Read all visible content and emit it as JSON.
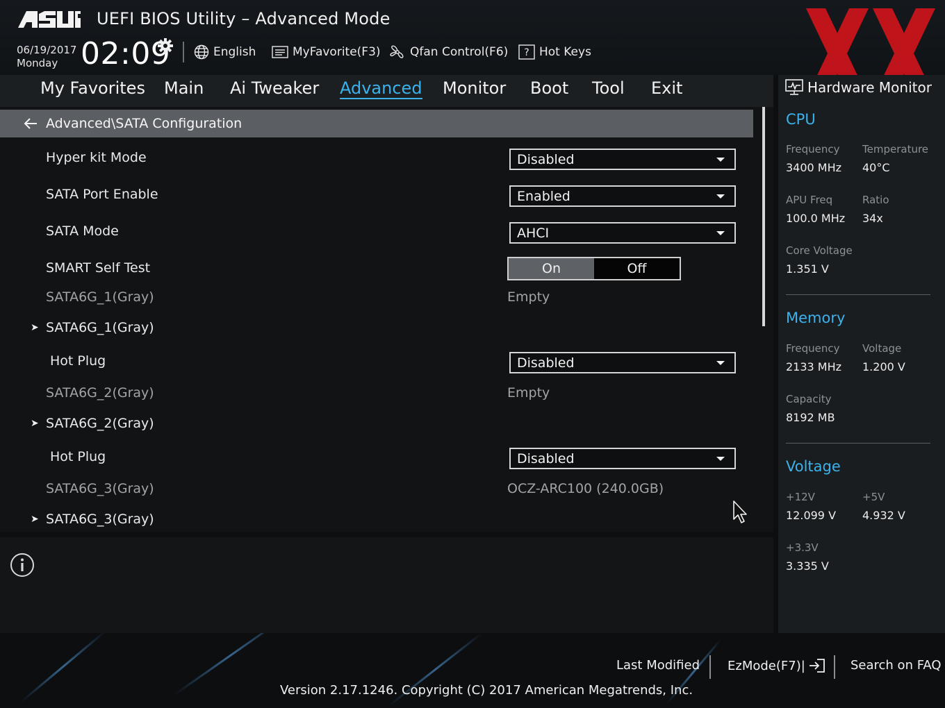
{
  "header": {
    "brand": "ASUS",
    "title": "UEFI BIOS Utility – Advanced Mode",
    "date": "06/19/2017",
    "day": "Monday",
    "time": "02:09",
    "language": "English",
    "myfavorite": "MyFavorite(F3)",
    "qfan": "Qfan Control(F6)",
    "hotkeys": "Hot Keys"
  },
  "nav": {
    "tabs": [
      "My Favorites",
      "Main",
      "Ai Tweaker",
      "Advanced",
      "Monitor",
      "Boot",
      "Tool",
      "Exit"
    ],
    "active": "Advanced"
  },
  "main": {
    "breadcrumb": "Advanced\\SATA Configuration",
    "hyperkit": {
      "label": "Hyper kit Mode",
      "value": "Disabled"
    },
    "sata_port_enable": {
      "label": "SATA Port Enable",
      "value": "Enabled"
    },
    "sata_mode": {
      "label": "SATA Mode",
      "value": "AHCI"
    },
    "smart": {
      "label": "SMART Self Test",
      "on": "On",
      "off": "Off",
      "selected": "On"
    },
    "port1": {
      "info_label": "SATA6G_1(Gray)",
      "info_value": "Empty",
      "sub_label": "SATA6G_1(Gray)",
      "hotplug_label": "Hot Plug",
      "hotplug_value": "Disabled"
    },
    "port2": {
      "info_label": "SATA6G_2(Gray)",
      "info_value": "Empty",
      "sub_label": "SATA6G_2(Gray)",
      "hotplug_label": "Hot Plug",
      "hotplug_value": "Disabled"
    },
    "port3": {
      "info_label": "SATA6G_3(Gray)",
      "info_value": "OCZ-ARC100 (240.0GB)",
      "sub_label": "SATA6G_3(Gray)"
    }
  },
  "hwmon": {
    "title": "Hardware Monitor",
    "cpu": {
      "heading": "CPU",
      "frequency_label": "Frequency",
      "frequency": "3400 MHz",
      "temperature_label": "Temperature",
      "temperature": "40°C",
      "apu_label": "APU Freq",
      "apu": "100.0 MHz",
      "ratio_label": "Ratio",
      "ratio": "34x",
      "core_voltage_label": "Core Voltage",
      "core_voltage": "1.351 V"
    },
    "memory": {
      "heading": "Memory",
      "frequency_label": "Frequency",
      "frequency": "2133 MHz",
      "voltage_label": "Voltage",
      "voltage": "1.200 V",
      "capacity_label": "Capacity",
      "capacity": "8192 MB"
    },
    "voltage": {
      "heading": "Voltage",
      "v12_label": "+12V",
      "v12": "12.099 V",
      "v5_label": "+5V",
      "v5": "4.932 V",
      "v33_label": "+3.3V",
      "v33": "3.335 V"
    }
  },
  "footer": {
    "last_modified": "Last Modified",
    "ezmode": "EzMode(F7)|",
    "search_faq": "Search on FAQ",
    "version": "Version 2.17.1246. Copyright (C) 2017 American Megatrends, Inc."
  },
  "colors": {
    "accent": "#3bb2ec",
    "watermark": "#d8141c",
    "panel": "#1a1d20"
  }
}
